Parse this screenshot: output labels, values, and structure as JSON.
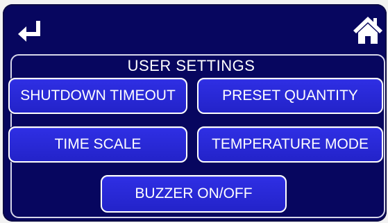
{
  "header": {
    "back_icon": "return-arrow-icon",
    "home_icon": "home-icon"
  },
  "panel": {
    "title": "USER SETTINGS"
  },
  "buttons": {
    "shutdown_timeout": "SHUTDOWN TIMEOUT",
    "preset_quantity": "PRESET QUANTITY",
    "time_scale": "TIME SCALE",
    "temperature_mode": "TEMPERATURE MODE",
    "buzzer": "BUZZER ON/OFF"
  },
  "colors": {
    "screen_background": "#07065f",
    "button_fill": "#2a2ad6",
    "button_border": "#ffffff",
    "text": "#ffffff"
  }
}
